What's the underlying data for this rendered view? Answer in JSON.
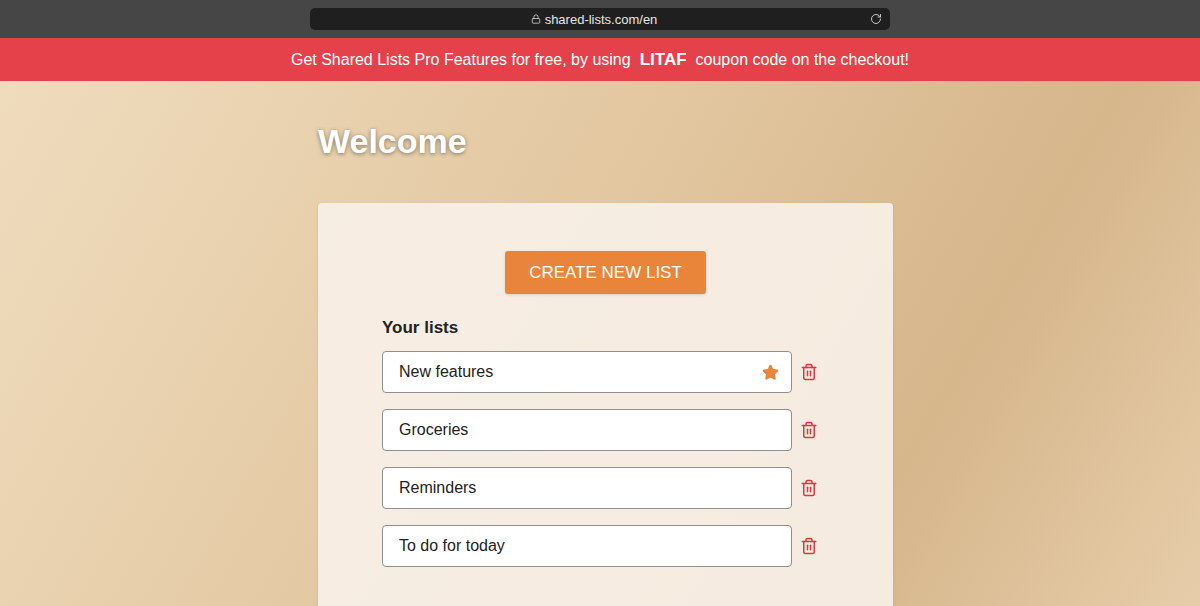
{
  "browser": {
    "url": "shared-lists.com/en"
  },
  "banner": {
    "before": "Get Shared Lists Pro Features for free, by using",
    "code": "LITAF",
    "after": "coupon code on the checkout!"
  },
  "heading": "Welcome",
  "create_button": "CREATE NEW LIST",
  "lists_title": "Your lists",
  "lists": [
    {
      "name": "New features",
      "starred": true
    },
    {
      "name": "Groceries",
      "starred": false
    },
    {
      "name": "Reminders",
      "starred": false
    },
    {
      "name": "To do for today",
      "starred": false
    }
  ]
}
